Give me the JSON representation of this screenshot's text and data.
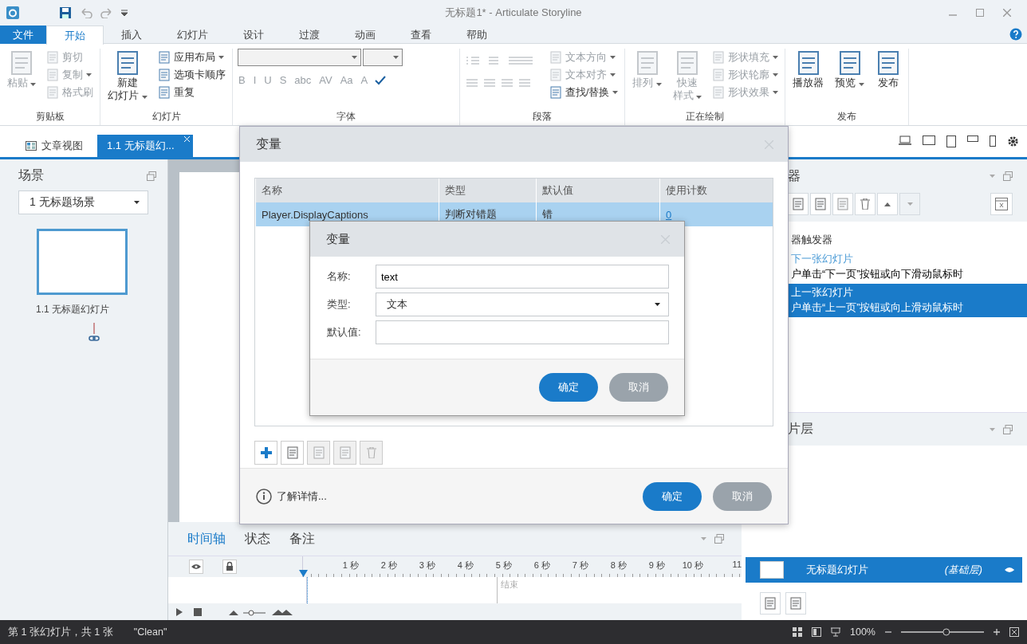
{
  "window": {
    "title": "无标题1* -  Articulate Storyline"
  },
  "ribbon": {
    "tabs": [
      {
        "label": "文件",
        "kind": "file",
        "selected": false
      },
      {
        "label": "开始",
        "kind": "tab",
        "selected": true
      },
      {
        "label": "插入",
        "kind": "tab",
        "selected": false
      },
      {
        "label": "幻灯片",
        "kind": "tab",
        "selected": false
      },
      {
        "label": "设计",
        "kind": "tab",
        "selected": false
      },
      {
        "label": "过渡",
        "kind": "tab",
        "selected": false
      },
      {
        "label": "动画",
        "kind": "tab",
        "selected": false
      },
      {
        "label": "查看",
        "kind": "tab",
        "selected": false
      },
      {
        "label": "帮助",
        "kind": "tab",
        "selected": false
      }
    ],
    "groups": [
      {
        "label": "剪贴板",
        "large": [
          {
            "lines": [
              "粘贴"
            ],
            "disabled": true,
            "menu": true
          }
        ],
        "small": [
          {
            "label": "剪切",
            "disabled": true,
            "menu": false
          },
          {
            "label": "复制",
            "disabled": true,
            "menu": true
          },
          {
            "label": "格式刷",
            "disabled": true,
            "menu": false
          }
        ]
      },
      {
        "label": "幻灯片",
        "large": [
          {
            "lines": [
              "新建",
              "幻灯片"
            ],
            "disabled": false,
            "menu": true
          }
        ],
        "small": [
          {
            "label": "应用布局",
            "disabled": false,
            "menu": true
          },
          {
            "label": "选项卡顺序",
            "disabled": false,
            "menu": false
          },
          {
            "label": "重复",
            "disabled": false,
            "menu": false
          }
        ]
      },
      {
        "label": "字体",
        "kind": "font",
        "tools": [
          {
            "label": "B",
            "disabled": true
          },
          {
            "label": "I",
            "disabled": true
          },
          {
            "label": "U",
            "disabled": true
          },
          {
            "label": "S",
            "disabled": true
          },
          {
            "label": "abc",
            "disabled": true
          },
          {
            "label": "AV",
            "disabled": true
          },
          {
            "label": "Aa",
            "disabled": true
          },
          {
            "label": "A",
            "disabled": true
          }
        ]
      },
      {
        "label": "段落",
        "kind": "paragraph",
        "small": [
          {
            "label": "文本方向",
            "disabled": true,
            "menu": true
          },
          {
            "label": "文本对齐",
            "disabled": true,
            "menu": true
          },
          {
            "label": "查找/替换",
            "disabled": false,
            "menu": true
          }
        ]
      },
      {
        "label": "正在绘制",
        "large": [
          {
            "lines": [
              "排列"
            ],
            "disabled": true,
            "menu": true
          },
          {
            "lines": [
              "快速",
              "样式"
            ],
            "disabled": true,
            "menu": true
          }
        ],
        "small": [
          {
            "label": "形状填充",
            "disabled": true,
            "menu": true
          },
          {
            "label": "形状轮廓",
            "disabled": true,
            "menu": true
          },
          {
            "label": "形状效果",
            "disabled": true,
            "menu": true
          }
        ]
      },
      {
        "label": "发布",
        "large": [
          {
            "lines": [
              "播放器"
            ],
            "disabled": false,
            "menu": false
          },
          {
            "lines": [
              "预览"
            ],
            "disabled": false,
            "menu": true
          },
          {
            "lines": [
              "发布"
            ],
            "disabled": false,
            "menu": false
          }
        ]
      }
    ]
  },
  "doc_tabs": [
    {
      "label": "文章视图",
      "selected": false
    },
    {
      "label": "1.1 无标题幻...",
      "selected": true
    }
  ],
  "scenes": {
    "title": "场景",
    "scene": "1 无标题场景",
    "slides": [
      {
        "label": "1.1 无标题幻灯片",
        "selected": true
      }
    ]
  },
  "timeline": {
    "tabs": [
      {
        "label": "时间轴",
        "selected": true
      },
      {
        "label": "状态",
        "selected": false
      },
      {
        "label": "备注",
        "selected": false
      }
    ],
    "ruler": [
      "1 秒",
      "2 秒",
      "3 秒",
      "4 秒",
      "5 秒",
      "6 秒",
      "7 秒",
      "8 秒",
      "9 秒",
      "10 秒",
      "11"
    ],
    "end_label": "结束"
  },
  "triggers": {
    "title": "器",
    "header": "器触发器",
    "items": [
      {
        "action": "下一张幻灯片",
        "condition": "户单击“下一页”按钮或向下滑动鼠标时",
        "selected": false
      },
      {
        "action": "上一张幻灯片",
        "condition": "户单击“上一页”按钮或向上滑动鼠标时",
        "selected": true
      }
    ]
  },
  "layers": {
    "title": "片层",
    "items": [
      {
        "name": "无标题幻灯片",
        "tag": "(基础层)",
        "selected": true
      }
    ]
  },
  "status_bar": {
    "slide": "第 1 张幻灯片，共 1 张",
    "theme": "\"Clean\"",
    "zoom": "100%",
    "zoom_slider": {
      "level": 0.55
    }
  },
  "variables_dialog": {
    "title": "变量",
    "columns": [
      "名称",
      "类型",
      "默认值",
      "使用计数"
    ],
    "rows": [
      {
        "name": "Player.DisplayCaptions",
        "type": "判断对错题",
        "default": "错",
        "uses": "0",
        "selected": true
      }
    ],
    "help": "了解详情...",
    "buttons": [
      {
        "label": "确定",
        "kind": "primary"
      },
      {
        "label": "取消",
        "kind": "secondary"
      }
    ]
  },
  "edit_dialog": {
    "title": "变量",
    "fields": [
      {
        "label": "名称:",
        "kind": "text",
        "value": "text"
      },
      {
        "label": "类型:",
        "kind": "select",
        "value": "文本"
      },
      {
        "label": "默认值:",
        "kind": "text"
      }
    ],
    "buttons": [
      {
        "label": "确定",
        "kind": "primary"
      },
      {
        "label": "取消",
        "kind": "secondary"
      }
    ]
  }
}
